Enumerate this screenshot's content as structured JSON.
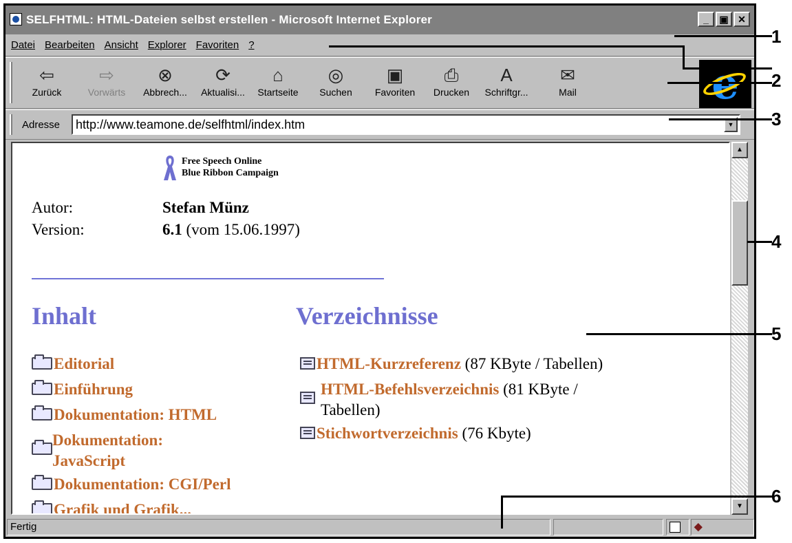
{
  "window": {
    "title": "SELFHTML: HTML-Dateien selbst erstellen - Microsoft Internet Explorer",
    "controls": [
      "_",
      "▣",
      "✕"
    ]
  },
  "menu": [
    "Datei",
    "Bearbeiten",
    "Ansicht",
    "Explorer",
    "Favoriten",
    "?"
  ],
  "toolbar": [
    {
      "label": "Zurück",
      "icon": "back-arrow-icon",
      "glyph": "⇦",
      "enabled": true
    },
    {
      "label": "Vorwärts",
      "icon": "forward-arrow-icon",
      "glyph": "⇨",
      "enabled": false
    },
    {
      "label": "Abbrech...",
      "icon": "stop-icon",
      "glyph": "⊗",
      "enabled": true
    },
    {
      "label": "Aktualisi...",
      "icon": "refresh-icon",
      "glyph": "⟳",
      "enabled": true
    },
    {
      "label": "Startseite",
      "icon": "home-icon",
      "glyph": "⌂",
      "enabled": true
    },
    {
      "label": "Suchen",
      "icon": "search-icon",
      "glyph": "◎",
      "enabled": true
    },
    {
      "label": "Favoriten",
      "icon": "favorites-folder-icon",
      "glyph": "▣",
      "enabled": true
    },
    {
      "label": "Drucken",
      "icon": "printer-icon",
      "glyph": "⎙",
      "enabled": true
    },
    {
      "label": "Schriftgr...",
      "icon": "font-size-icon",
      "glyph": "A",
      "enabled": true
    },
    {
      "label": "Mail",
      "icon": "mail-icon",
      "glyph": "✉",
      "enabled": true
    }
  ],
  "address": {
    "label": "Adresse",
    "url": "http://www.teamone.de/selfhtml/index.htm"
  },
  "page": {
    "ribbon": {
      "line1": "Free Speech Online",
      "line2": "Blue Ribbon Campaign",
      "color": "#6e6fd0"
    },
    "author_label": "Autor:",
    "author": "Stefan Münz",
    "version_label": "Version:",
    "version_num": "6.1",
    "version_date": " (vom 15.06.1997)",
    "inhalt": {
      "heading": "Inhalt",
      "items": [
        "Editorial",
        "Einführung",
        "Dokumentation: HTML",
        "Dokumentation:",
        "JavaScript",
        "Dokumentation: CGI/Perl",
        "Grafik und Grafik..."
      ]
    },
    "verzeichnisse": {
      "heading": "Verzeichnisse",
      "items": [
        {
          "link": "HTML-Kurzreferenz",
          "note": " (87 KByte / Tabellen)"
        },
        {
          "link": "HTML-Befehlsverzeichnis",
          "note": " (81 KByte /",
          "note2": "Tabellen)"
        },
        {
          "link": "Stichwortverzeichnis",
          "note": " (76 Kbyte)"
        }
      ]
    },
    "link_color": "#c16a2d",
    "heading_color": "#6e6fd0"
  },
  "status": {
    "text": "Fertig"
  },
  "callouts": [
    "1",
    "2",
    "3",
    "4",
    "5",
    "6"
  ]
}
